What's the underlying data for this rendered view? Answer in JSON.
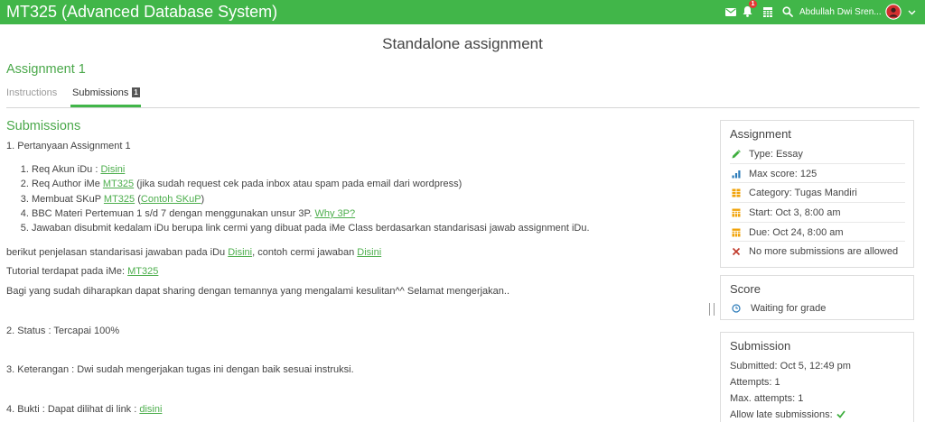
{
  "theme": {
    "topbar": "#41b649",
    "heading": "#4aa84a",
    "link": "#4cae4c"
  },
  "topbar": {
    "course_title": "MT325 (Advanced Database System)",
    "icons": {
      "mail": "envelope-icon",
      "notifications": "bell-icon",
      "calendar": "calendar-icon",
      "search": "search-icon",
      "account_menu": "chevron-down-icon"
    },
    "notification_count": "1",
    "user_name": "Abdullah Dwi Sren..."
  },
  "page": {
    "heading": "Standalone assignment",
    "assignment_title": "Assignment 1"
  },
  "tabs": [
    {
      "label": "Instructions",
      "active": false
    },
    {
      "label": "Submissions",
      "badge": "1",
      "active": true
    }
  ],
  "submissions": {
    "heading": "Submissions",
    "question_title": "1. Pertanyaan Assignment 1",
    "steps": [
      {
        "text": "Req Akun iDu : ",
        "link": "Disini"
      },
      {
        "text": "Req Author iMe ",
        "link": "MT325",
        "after": " (jika sudah request cek pada inbox atau spam pada email dari wordpress)"
      },
      {
        "text": "Membuat SKuP ",
        "link": "MT325",
        "middle": " (",
        "link2": "Contoh SKuP",
        "after": ")"
      },
      {
        "text": "BBC Materi Pertemuan 1 s/d 7 dengan menggunakan unsur 3P. ",
        "link": "Why 3P?"
      },
      {
        "text": "Jawaban disubmit kedalam iDu berupa link cermi yang dibuat pada iMe Class berdasarkan standarisasi jawab assignment iDu."
      }
    ],
    "standard_note": {
      "text": "berikut penjelasan standarisasi jawaban pada iDu ",
      "link": "Disini",
      "middle": ", contoh cermi jawaban ",
      "link2": "Disini"
    },
    "tutorial": {
      "text": "Tutorial terdapat pada iMe: ",
      "link": "MT325"
    },
    "closing": "Bagi yang sudah diharapkan dapat sharing dengan temannya yang mengalami kesulitan^^ Selamat mengerjakan..",
    "status": "2. Status : Tercapai 100%",
    "remarks": "3. Keterangan : Dwi sudah mengerjakan tugas ini dengan baik sesuai instruksi.",
    "evidence": {
      "text": "4. Bukti : Dapat dilihat di link : ",
      "link": "disini"
    }
  },
  "sidebar": {
    "assignment": {
      "title": "Assignment",
      "rows": [
        {
          "icon": "pencil-icon",
          "color": "#3fae3f",
          "text": "Type: Essay"
        },
        {
          "icon": "bar-chart-icon",
          "color": "#2b7bb9",
          "text": "Max score: 125"
        },
        {
          "icon": "category-icon",
          "color": "#f0a30a",
          "text": "Category: Tugas Mandiri"
        },
        {
          "icon": "calendar-icon",
          "color": "#f0a30a",
          "text": "Start: Oct 3, 8:00 am"
        },
        {
          "icon": "calendar-icon",
          "color": "#f0a30a",
          "text": "Due: Oct 24, 8:00 am"
        },
        {
          "icon": "close-icon",
          "color": "#c0392b",
          "text": "No more submissions are allowed"
        }
      ]
    },
    "score": {
      "title": "Score",
      "icon": "clock-icon",
      "color": "#2b7bb9",
      "status": "Waiting for grade"
    },
    "submission": {
      "title": "Submission",
      "submitted": "Submitted: Oct 5, 12:49 pm",
      "attempts": "Attempts: 1",
      "max_attempts": "Max. attempts: 1",
      "late_label": "Allow late submissions:",
      "late_icon": "check-icon",
      "late_color": "#3fae3f"
    }
  }
}
